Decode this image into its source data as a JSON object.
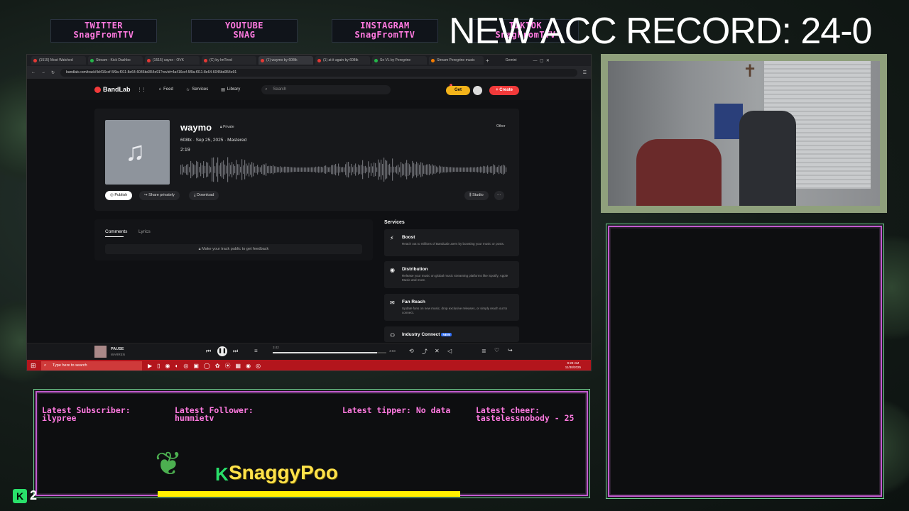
{
  "socials": [
    {
      "label": "TWITTER",
      "handle": "SnagFromTTV"
    },
    {
      "label": "YOUTUBE",
      "handle": "SNAG"
    },
    {
      "label": "INSTAGRAM",
      "handle": "SnagFromTTV"
    },
    {
      "label": "TIKTOK",
      "handle": "SnagFromTTV"
    }
  ],
  "record": "NEW ACC RECORD: 24-0",
  "browser": {
    "tabs": [
      "(1515) Most Watched",
      "Stream - Kick Dashbo",
      "(1515) sayox - OVK",
      "(C) by ImTired",
      "(1) waymo by 608tk",
      "(1) at it again by 608tk",
      "So VL by Peregrine",
      "Stream Peregrine music"
    ],
    "gemini": "Gemini",
    "url": "bandlab.com/track/4d416ccf-5f9a-f011-8e64-6045bd354e91?revId=4a416ccf-5f9a-f011-8e64-6045bd354e91"
  },
  "bandlab": {
    "logo": "BandLab",
    "nav": [
      "Feed",
      "Services",
      "Library"
    ],
    "search_placeholder": "Search",
    "notif_count": "1",
    "get_label": "Get",
    "create_label": "+ Create",
    "track": {
      "title": "waymo",
      "privacy": "Private",
      "meta": "608tk · Sep 25, 2025 · Mastered",
      "duration": "2:19",
      "genre": "Other",
      "publish": "Publish",
      "share": "Share privately",
      "download": "Download",
      "studio": "Studio",
      "more": "···"
    },
    "comments": {
      "tab_comments": "Comments",
      "tab_lyrics": "Lyrics",
      "locked": "Make your track public to get feedback"
    },
    "services": {
      "heading": "Services",
      "items": [
        {
          "name": "Boost",
          "desc": "Reach out to millions of BandLab users by boosting your music or posts."
        },
        {
          "name": "Distribution",
          "desc": "Release your music on global music streaming platforms like Spotify, Apple Music and more."
        },
        {
          "name": "Fan Reach",
          "desc": "Update fans on new music, drop exclusive releases, or simply reach out to connect."
        },
        {
          "name": "Industry Connect",
          "badge": "NEW",
          "desc": ""
        }
      ]
    },
    "player": {
      "status": "PAUSE",
      "artist": "WARREN",
      "elapsed": "3:42",
      "total": "4:03",
      "progress": 0.92
    }
  },
  "taskbar": {
    "search": "Type here to search",
    "time": "9:29 AM",
    "date": "11/30/2025"
  },
  "alerts": {
    "sub_label": "Latest Subscriber:",
    "sub_value": "ilypree",
    "fol_label": "Latest Follower:",
    "fol_value": "hummietv",
    "tip_label": "Latest tipper: No data",
    "cheer_label": "Latest cheer:",
    "cheer_value": "tastelessnobody - 25"
  },
  "streamer": "SnaggyPoo",
  "kick_count": "2",
  "colors": {
    "accent_pink": "#ff7ae0",
    "bandlab_red": "#f23a3a",
    "kick_green": "#29e06a",
    "bar_yellow": "#fff000"
  }
}
